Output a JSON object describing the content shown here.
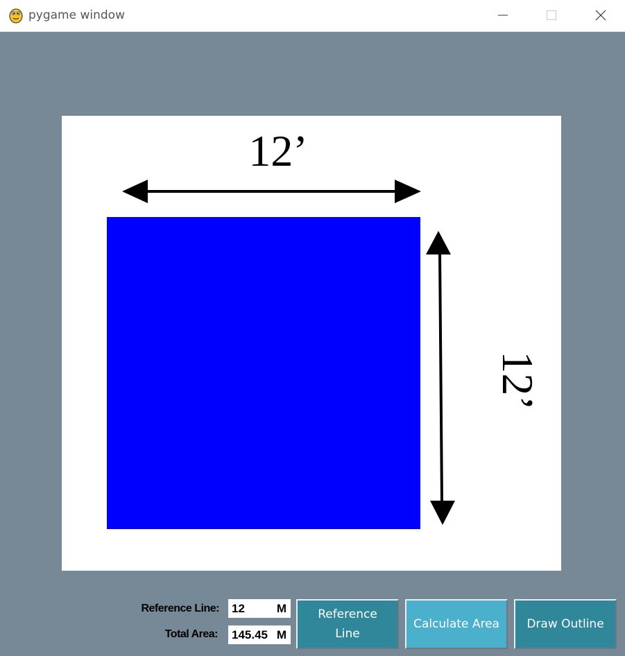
{
  "window": {
    "title": "pygame window",
    "controls": [
      "minimize-icon",
      "maximize-icon",
      "close-icon"
    ]
  },
  "drawing": {
    "top_dimension": "12’",
    "side_dimension": "12’",
    "shape_color": "#0000ff",
    "background_color": "#778896"
  },
  "controls": {
    "reference_line_label": "Reference Line:",
    "reference_line_value": "12",
    "reference_line_unit": "M",
    "total_area_label": "Total Area:",
    "total_area_value": "145.45",
    "total_area_unit": "M",
    "buttons": {
      "reference_line": "Reference Line",
      "calculate_area": "Calculate Area",
      "draw_outline": "Draw Outline"
    },
    "button_color": "#2f8799",
    "active_button_color": "#4ab0cc"
  }
}
